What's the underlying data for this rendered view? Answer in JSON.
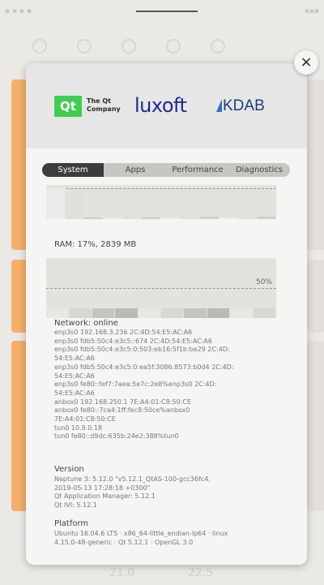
{
  "modal": {
    "logos": {
      "qt_mark": "Qt",
      "qt_company": "The Qt Company",
      "luxoft": "luxoft",
      "kdab": "KDAB"
    },
    "close_label": "×",
    "tabs": [
      {
        "label": "System",
        "active": true
      },
      {
        "label": "Apps",
        "active": false
      },
      {
        "label": "Performance",
        "active": false
      },
      {
        "label": "Diagnostics",
        "active": false
      }
    ],
    "ram": {
      "label": "RAM: 17%, 2839 MB",
      "threshold_label": "50%"
    },
    "network": {
      "title": "Network: online",
      "lines": "enp3s0 192.168.3.236 2C:4D:54:E5:AC:A6\nenp3s0 fdb5:50c4:e3c5::674 2C:4D:54:E5:AC:A6\nenp3s0 fdb5:50c4:e3c5:0:503:eb16:5f1b:be29 2C:4D:\n54:E5:AC:A6\nenp3s0 fdb5:50c4:e3c5:0:ea5f:3086:8573:b0d4 2C:4D:\n54:E5:AC:A6\nenp3s0 fe80::fef7:7aea:5e7c:2e8%enp3s0 2C:4D:\n54:E5:AC:A6\nanbox0 192.168.250.1 7E:A4:01:C8:50:CE\nanbox0 fe80::7ca4:1ff:fec8:50ce%anbox0\n7E:A4:01:C8:50:CE\ntun0 10.9.0.18\ntun0 fe80::d9dc:635b:24e2:388%tun0"
    },
    "version": {
      "title": "Version",
      "lines": "Neptune 3: 5.12.0 \"v5.12.1_QtAS-100-gcc36fc4,\n2019-05-13 17:28:18 +0300\"\nQt Application Manager: 5.12.1\nQt IVI: 5.12.1"
    },
    "platform": {
      "title": "Platform",
      "lines": "Ubuntu 16.04.6 LTS · x86_64-little_endian-lp64 · linux\n4.15.0-48-generic · Qt 5.12.1 · OpenGL 3.0"
    }
  },
  "background": {
    "bottom_left_value": "21.0",
    "bottom_right_value": "22.5"
  },
  "colors": {
    "accent_orange": "#f4b06a",
    "qt_green": "#41cd52",
    "luxoft_blue": "#22288c",
    "kdab_blue": "#1f3d7a",
    "tab_active": "#3d3d3d"
  }
}
